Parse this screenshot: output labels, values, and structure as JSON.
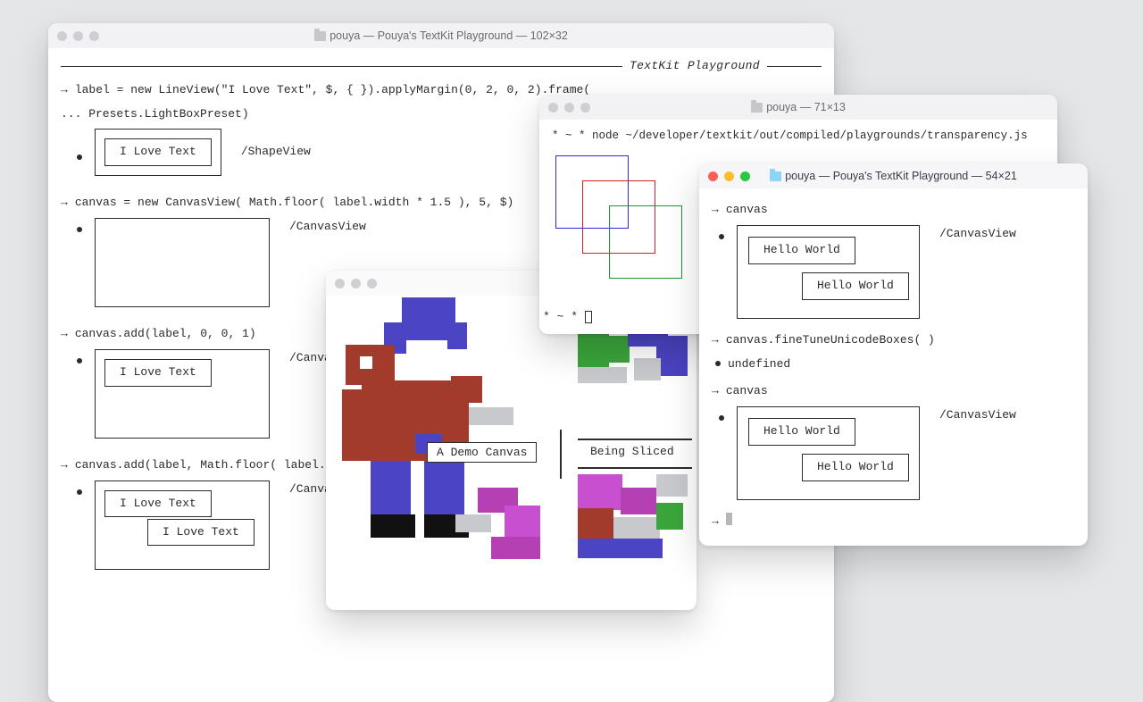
{
  "windows": {
    "main": {
      "title": "pouya — Pouya's TextKit Playground — 102×32",
      "heading": "TextKit Playground",
      "line1": "label = new LineView(\"I Love Text\", $, { }).applyMargin(0, 2, 0, 2).frame(",
      "line1b": "... Presets.LightBoxPreset)",
      "love": "I Love Text",
      "shapeview": "/ShapeView",
      "line2": "canvas = new CanvasView( Math.floor( label.width * 1.5 ), 5, $)",
      "canvasview": "/CanvasView",
      "line3": "canvas.add(label, 0, 0, 1)",
      "canvasv_cut": "/CanvasV",
      "line4": "canvas.add(label, Math.floor( label.",
      "canvasview_cut2": "/CanvasVi"
    },
    "pixel": {
      "label1": "A Demo Canvas",
      "label2": "Being Sliced"
    },
    "transp": {
      "title": "pouya — 71×13",
      "cmd": "* ~ * node ~/developer/textkit/out/compiled/playgrounds/transparency.js",
      "prompt_end": "* ~ *"
    },
    "right": {
      "title": "pouya — Pouya's TextKit Playground — 54×21",
      "l1": "canvas",
      "hello": "Hello World",
      "canvasview": "/CanvasView",
      "l2": "canvas.fineTuneUnicodeBoxes( )",
      "l3": "undefined",
      "l4": "canvas"
    }
  }
}
